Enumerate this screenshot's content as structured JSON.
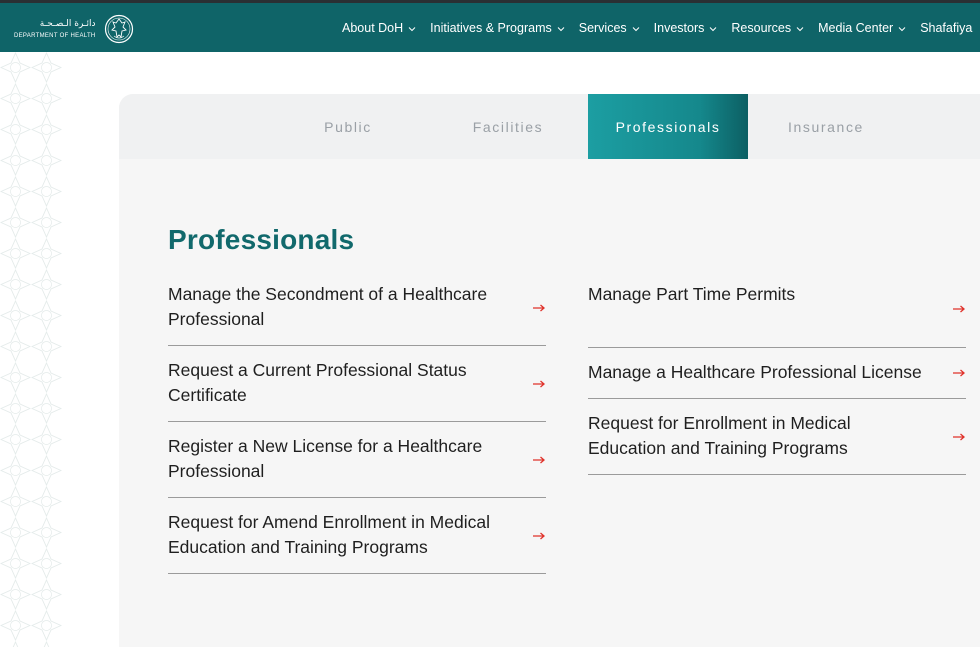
{
  "header": {
    "logo": {
      "arabic_text": "دائـرة الـصـحـة",
      "english_text": "DEPARTMENT OF HEALTH"
    },
    "nav": [
      {
        "label": "About DoH",
        "has_dropdown": true
      },
      {
        "label": "Initiatives & Programs",
        "has_dropdown": true
      },
      {
        "label": "Services",
        "has_dropdown": true
      },
      {
        "label": "Investors",
        "has_dropdown": true
      },
      {
        "label": "Resources",
        "has_dropdown": true
      },
      {
        "label": "Media Center",
        "has_dropdown": true
      },
      {
        "label": "Shafafiya",
        "has_dropdown": false
      }
    ]
  },
  "tabs": [
    {
      "label": "Public",
      "active": false
    },
    {
      "label": "Facilities",
      "active": false
    },
    {
      "label": "Professionals",
      "active": true
    },
    {
      "label": "Insurance",
      "active": false
    }
  ],
  "section": {
    "title": "Professionals",
    "left_items": [
      {
        "label": "Manage the Secondment of a Healthcare Professional"
      },
      {
        "label": "Request a Current Professional Status Certificate"
      },
      {
        "label": "Register a New License for a Healthcare Professional"
      },
      {
        "label": "Request for Amend Enrollment in Medical Education and Training Programs"
      }
    ],
    "right_items": [
      {
        "label": "Manage Part Time Permits"
      },
      {
        "label": "Manage a Healthcare Professional License"
      },
      {
        "label": "Request for Enrollment in Medical Education and Training Programs"
      }
    ]
  },
  "colors": {
    "header_bg": "#0f6468",
    "accent": "#11696c",
    "tab_active": "#1c9ea2",
    "arrow": "#e0322b",
    "card_bg": "#f6f6f6"
  },
  "icons": {
    "item_arrow": "arrow-right-icon",
    "nav_chevron": "chevron-down-icon",
    "logo": "falcon-emblem-icon"
  }
}
